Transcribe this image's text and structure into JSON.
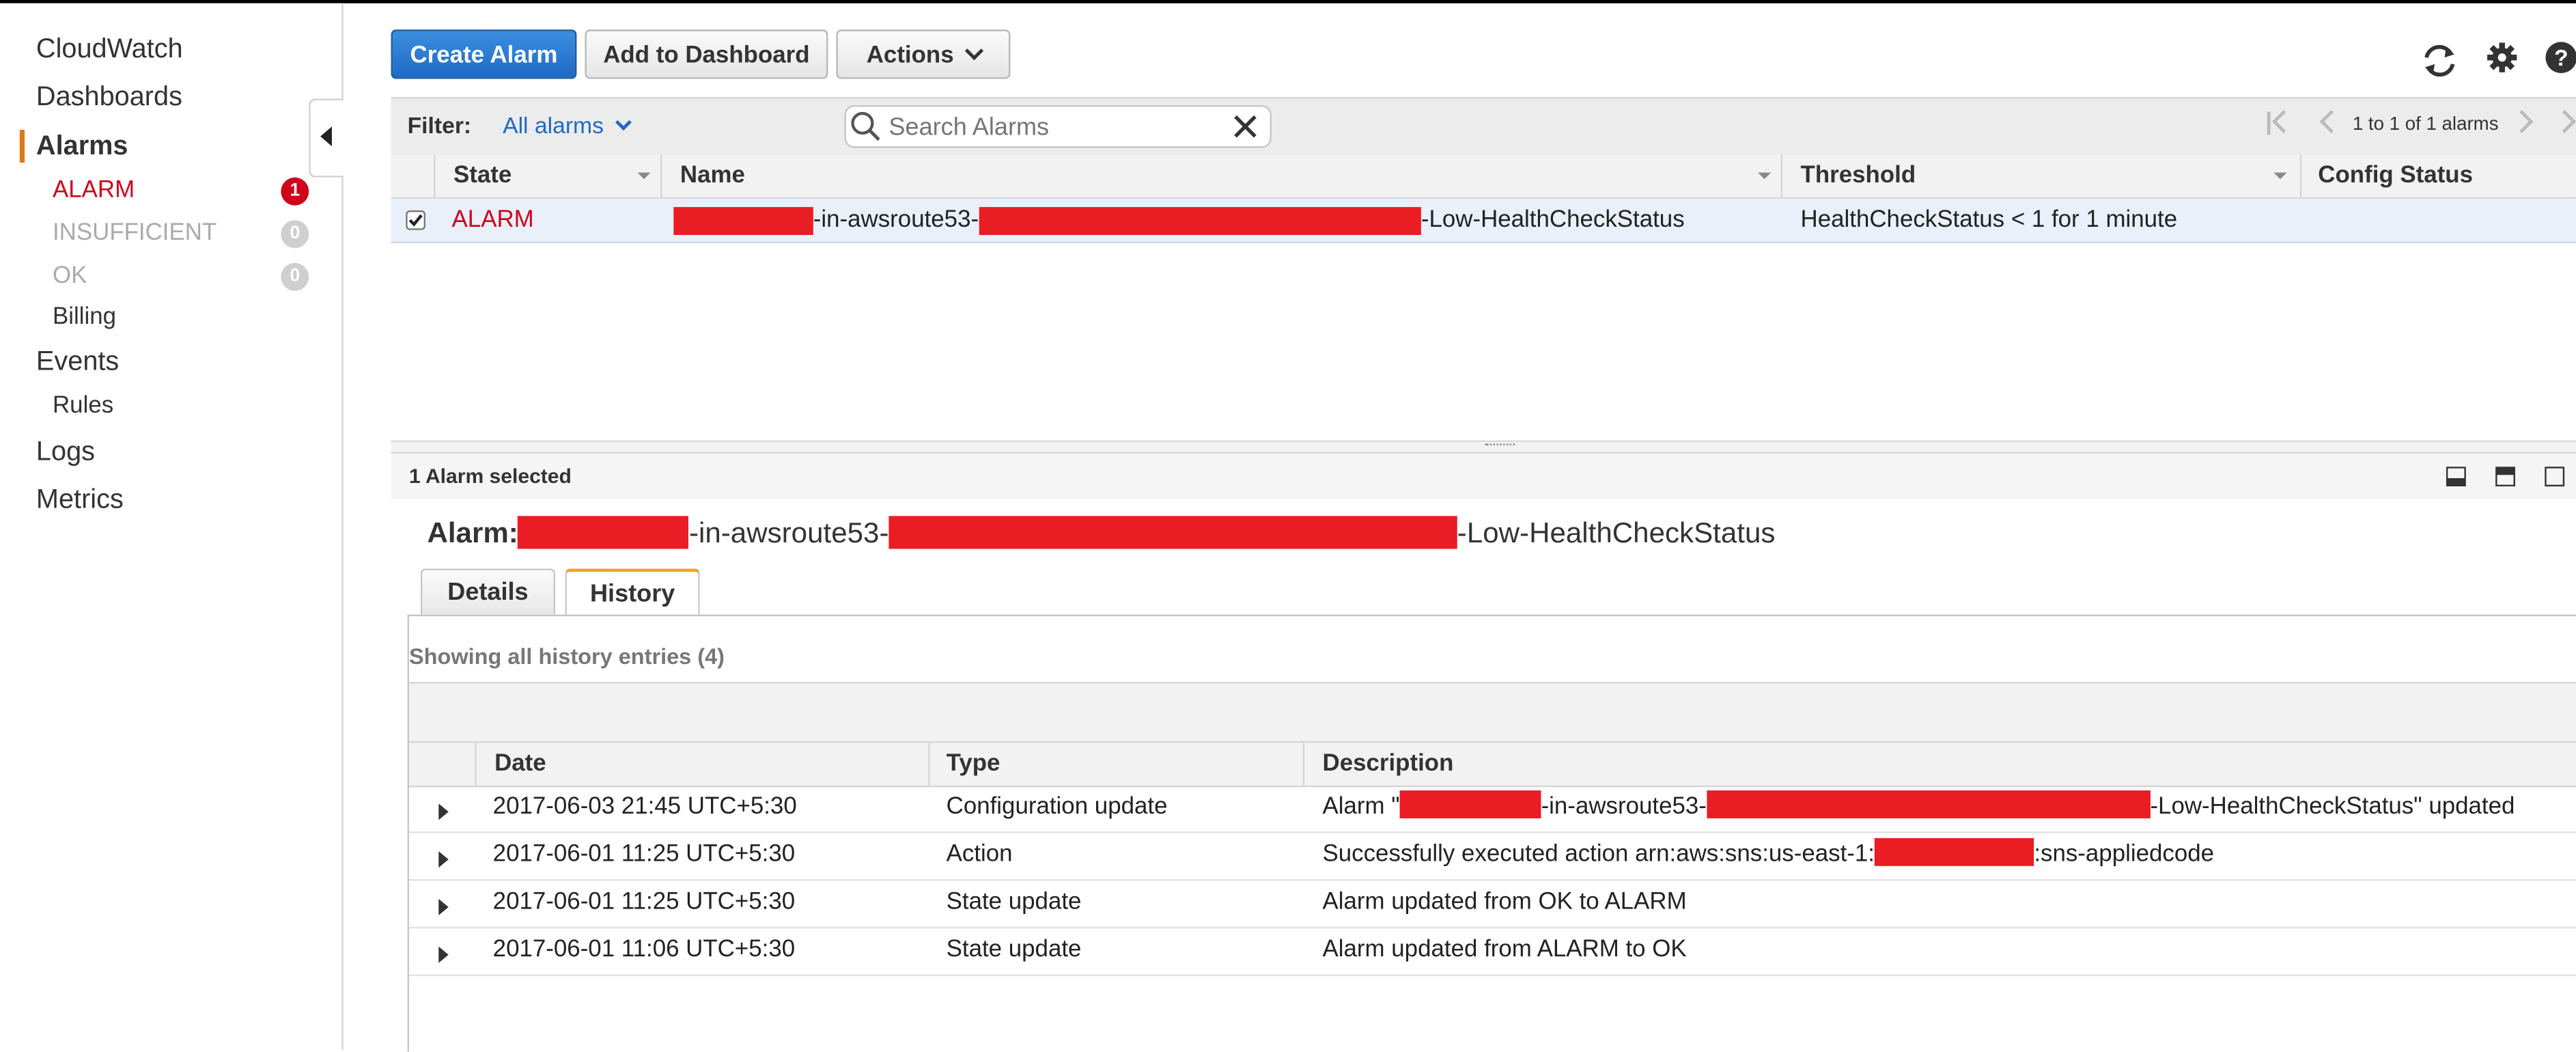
{
  "sidebar": {
    "items": [
      {
        "label": "CloudWatch"
      },
      {
        "label": "Dashboards"
      },
      {
        "label": "Alarms"
      },
      {
        "label": "ALARM",
        "count": "1"
      },
      {
        "label": "INSUFFICIENT",
        "count": "0"
      },
      {
        "label": "OK",
        "count": "0"
      },
      {
        "label": "Billing"
      },
      {
        "label": "Events"
      },
      {
        "label": "Rules"
      },
      {
        "label": "Logs"
      },
      {
        "label": "Metrics"
      }
    ]
  },
  "toolbar": {
    "create_label": "Create Alarm",
    "add_dashboard_label": "Add to Dashboard",
    "actions_label": "Actions"
  },
  "filter": {
    "label": "Filter:",
    "value": "All alarms",
    "search_placeholder": "Search Alarms",
    "pagination": "1 to 1 of 1 alarms"
  },
  "table": {
    "headers": [
      "State",
      "Name",
      "Threshold",
      "Config Status"
    ],
    "row": {
      "state": "ALARM",
      "name_part1": "-in-awsroute53-",
      "name_part2": "-Low-HealthCheckStatus",
      "threshold": "HealthCheckStatus < 1 for 1 minute",
      "config_status": ""
    }
  },
  "detail": {
    "selected_text": "1 Alarm selected",
    "alarm_label": "Alarm:",
    "alarm_part1": "-in-awsroute53-",
    "alarm_part2": "-Low-HealthCheckStatus",
    "tabs": [
      "Details",
      "History"
    ],
    "history_summary": "Showing all history entries (4)",
    "history_headers": [
      "Date",
      "Type",
      "Description"
    ],
    "history_rows": [
      {
        "date": "2017-06-03 21:45 UTC+5:30",
        "type": "Configuration update",
        "desc_a": "Alarm \"",
        "desc_b": "-in-awsroute53-",
        "desc_c": "-Low-HealthCheckStatus\" updated"
      },
      {
        "date": "2017-06-01 11:25 UTC+5:30",
        "type": "Action",
        "desc_a": "Successfully executed action arn:aws:sns:us-east-1:",
        "desc_c": ":sns-appliedcode"
      },
      {
        "date": "2017-06-01 11:25 UTC+5:30",
        "type": "State update",
        "desc_a": "Alarm updated from OK to ALARM"
      },
      {
        "date": "2017-06-01 11:06 UTC+5:30",
        "type": "State update",
        "desc_a": "Alarm updated from ALARM to OK"
      }
    ]
  },
  "colors": {
    "accent": "#1f6ac4",
    "alarm_red": "#d0021b",
    "redaction": "#ea1c24",
    "active_nav_bar": "#e07a17"
  },
  "icons": [
    "collapse-sidebar-icon",
    "refresh-icon",
    "settings-gear-icon",
    "help-icon",
    "search-icon",
    "clear-search-icon",
    "first-page-icon",
    "prev-page-icon",
    "next-page-icon",
    "last-page-icon",
    "dock-bottom-icon",
    "dock-half-icon",
    "maximize-icon",
    "expand-row-icon",
    "checkbox-icon"
  ]
}
